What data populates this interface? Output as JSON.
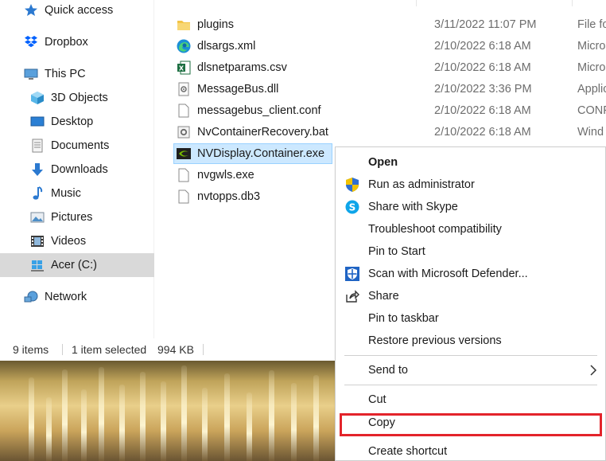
{
  "nav": {
    "items": [
      {
        "label": "Quick access",
        "icon": "star-icon"
      },
      {
        "label": "Dropbox",
        "icon": "dropbox-icon"
      },
      {
        "label": "This PC",
        "icon": "computer-icon"
      },
      {
        "label": "3D Objects",
        "icon": "cube-icon"
      },
      {
        "label": "Desktop",
        "icon": "desktop-icon"
      },
      {
        "label": "Documents",
        "icon": "document-icon"
      },
      {
        "label": "Downloads",
        "icon": "download-arrow-icon"
      },
      {
        "label": "Music",
        "icon": "music-note-icon"
      },
      {
        "label": "Pictures",
        "icon": "picture-icon"
      },
      {
        "label": "Videos",
        "icon": "film-icon"
      },
      {
        "label": "Acer (C:)",
        "icon": "drive-icon",
        "selected": true
      },
      {
        "label": "Network",
        "icon": "network-icon"
      }
    ]
  },
  "files": [
    {
      "name": "plugins",
      "date": "3/11/2022 11:07 PM",
      "type": "File fo",
      "icon": "folder-icon"
    },
    {
      "name": "dlsargs.xml",
      "date": "2/10/2022 6:18 AM",
      "type": "Micro",
      "icon": "edge-icon"
    },
    {
      "name": "dlsnetparams.csv",
      "date": "2/10/2022 6:18 AM",
      "type": "Micro",
      "icon": "excel-icon"
    },
    {
      "name": "MessageBus.dll",
      "date": "2/10/2022 3:36 PM",
      "type": "Applic",
      "icon": "dll-icon"
    },
    {
      "name": "messagebus_client.conf",
      "date": "2/10/2022 6:18 AM",
      "type": "CONF",
      "icon": "blank-file-icon"
    },
    {
      "name": "NvContainerRecovery.bat",
      "date": "2/10/2022 6:18 AM",
      "type": "Wind",
      "icon": "batch-file-icon"
    },
    {
      "name": "NVDisplay.Container.exe",
      "date": "",
      "type": "",
      "icon": "nvidia-icon",
      "selected": true
    },
    {
      "name": "nvgwls.exe",
      "date": "",
      "type": "",
      "icon": "exe-icon"
    },
    {
      "name": "nvtopps.db3",
      "date": "",
      "type": "",
      "icon": "blank-file-icon"
    }
  ],
  "status": {
    "count": "9 items",
    "selected": "1 item selected",
    "size": "994 KB"
  },
  "menu": {
    "open": "Open",
    "run_as_admin": "Run as administrator",
    "share_skype": "Share with Skype",
    "troubleshoot": "Troubleshoot compatibility",
    "pin_start": "Pin to Start",
    "scan_defender": "Scan with Microsoft Defender...",
    "share": "Share",
    "pin_taskbar": "Pin to taskbar",
    "restore_versions": "Restore previous versions",
    "send_to": "Send to",
    "cut": "Cut",
    "copy": "Copy",
    "create_shortcut": "Create shortcut"
  },
  "colors": {
    "selection_bg": "#cce8ff",
    "nav_selected_bg": "#d9d9d9",
    "highlight_red": "#e3242b"
  }
}
